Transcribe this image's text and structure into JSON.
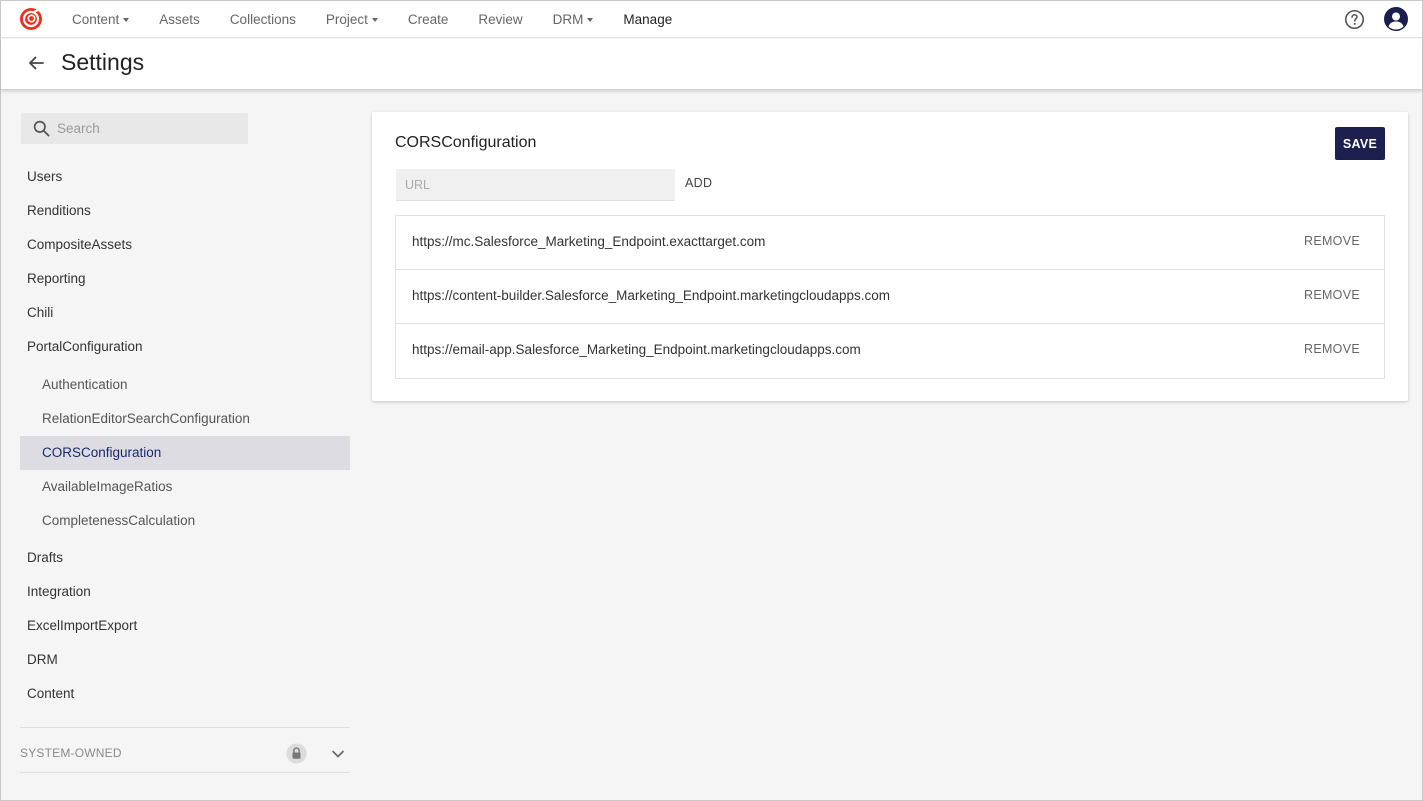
{
  "nav": {
    "items": [
      {
        "label": "Content",
        "dropdown": true
      },
      {
        "label": "Assets",
        "dropdown": false
      },
      {
        "label": "Collections",
        "dropdown": false
      },
      {
        "label": "Project",
        "dropdown": true
      },
      {
        "label": "Create",
        "dropdown": false
      },
      {
        "label": "Review",
        "dropdown": false
      },
      {
        "label": "DRM",
        "dropdown": true
      },
      {
        "label": "Manage",
        "dropdown": false,
        "active": true
      }
    ],
    "logo_icon": "app-logo-icon",
    "help_icon": "help-circle-icon",
    "avatar_icon": "user-avatar-icon",
    "brand_color": "#e8321e"
  },
  "header": {
    "title": "Settings",
    "back_icon": "arrow-left-icon"
  },
  "sidebar": {
    "search_placeholder": "Search",
    "items": [
      {
        "label": "Users",
        "level": 0
      },
      {
        "label": "Renditions",
        "level": 0
      },
      {
        "label": "CompositeAssets",
        "level": 0
      },
      {
        "label": "Reporting",
        "level": 0
      },
      {
        "label": "Chili",
        "level": 0
      },
      {
        "label": "PortalConfiguration",
        "level": 0
      },
      {
        "label": "Authentication",
        "level": 1
      },
      {
        "label": "RelationEditorSearchConfiguration",
        "level": 1
      },
      {
        "label": "CORSConfiguration",
        "level": 1,
        "selected": true
      },
      {
        "label": "AvailableImageRatios",
        "level": 1
      },
      {
        "label": "CompletenessCalculation",
        "level": 1
      },
      {
        "label": "Drafts",
        "level": 0
      },
      {
        "label": "Integration",
        "level": 0
      },
      {
        "label": "ExcelImportExport",
        "level": 0
      },
      {
        "label": "DRM",
        "level": 0
      },
      {
        "label": "Content",
        "level": 0
      }
    ],
    "system_owned_label": "SYSTEM-OWNED",
    "selected_bg": "#dcdce2"
  },
  "main": {
    "title": "CORSConfiguration",
    "save_label": "SAVE",
    "url_placeholder": "URL",
    "add_label": "ADD",
    "remove_label": "REMOVE",
    "urls": [
      "https://mc.Salesforce_Marketing_Endpoint.exacttarget.com",
      "https://content-builder.Salesforce_Marketing_Endpoint.marketingcloudapps.com",
      "https://email-app.Salesforce_Marketing_Endpoint.marketingcloudapps.com"
    ],
    "save_color": "#1d1f4e"
  }
}
